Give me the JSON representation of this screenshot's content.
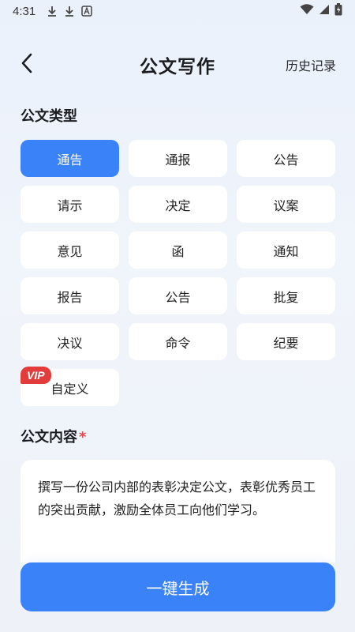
{
  "status_bar": {
    "time": "4:31",
    "icons_left": [
      "download-icon",
      "download-icon",
      "app-icon"
    ],
    "icons_right": [
      "wifi-icon",
      "signal-icon",
      "battery-icon"
    ]
  },
  "header": {
    "title": "公文写作",
    "history_label": "历史记录"
  },
  "type_section": {
    "title": "公文类型",
    "selected": "通告",
    "items": [
      {
        "label": "通告",
        "active": true
      },
      {
        "label": "通报"
      },
      {
        "label": "公告"
      },
      {
        "label": "请示"
      },
      {
        "label": "决定"
      },
      {
        "label": "议案"
      },
      {
        "label": "意见"
      },
      {
        "label": "函"
      },
      {
        "label": "通知"
      },
      {
        "label": "报告"
      },
      {
        "label": "公告"
      },
      {
        "label": "批复"
      },
      {
        "label": "决议"
      },
      {
        "label": "命令"
      },
      {
        "label": "纪要"
      },
      {
        "label": "自定义",
        "badge": "VIP"
      }
    ]
  },
  "content_section": {
    "title": "公文内容",
    "required_mark": "*",
    "text": "撰写一份公司内部的表彰决定公文，表彰优秀员工的突出贡献，激励全体员工向他们学习。"
  },
  "generate_button": {
    "label": "一键生成"
  },
  "colors": {
    "accent": "#3a82f7",
    "vip": "#e23c3c",
    "required": "#e5484d"
  }
}
